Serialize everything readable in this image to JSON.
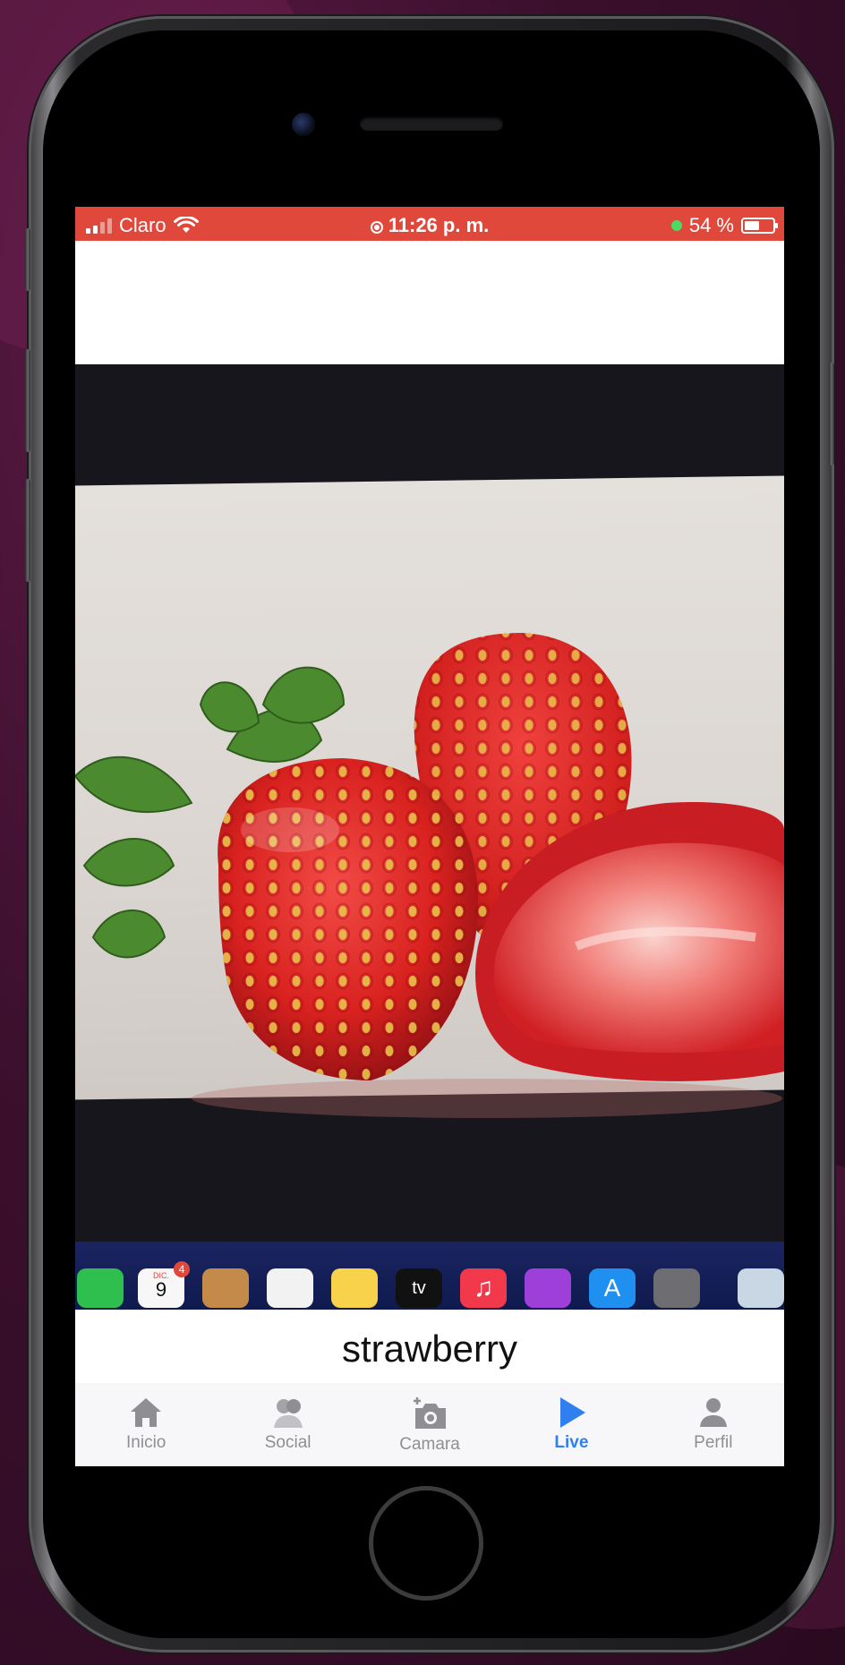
{
  "status_bar": {
    "carrier": "Claro",
    "time": "11:26 p. m.",
    "battery_percent_label": "54 %",
    "battery_level": 0.54,
    "signal_bars": 2,
    "background_color": "#e0483b"
  },
  "main": {
    "caption": "strawberry",
    "dock_calendar": {
      "month": "DIC.",
      "day": "9",
      "badge": "4"
    },
    "dock_tv_label": "tv"
  },
  "tab_bar": {
    "active_color": "#2f7ff0",
    "items": [
      {
        "label": "Inicio",
        "icon": "house-icon"
      },
      {
        "label": "Social",
        "icon": "people-icon"
      },
      {
        "label": "Camara",
        "icon": "camera-plus-icon"
      },
      {
        "label": "Live",
        "icon": "play-icon"
      },
      {
        "label": "Perfil",
        "icon": "person-icon"
      }
    ],
    "active_index": 3
  }
}
